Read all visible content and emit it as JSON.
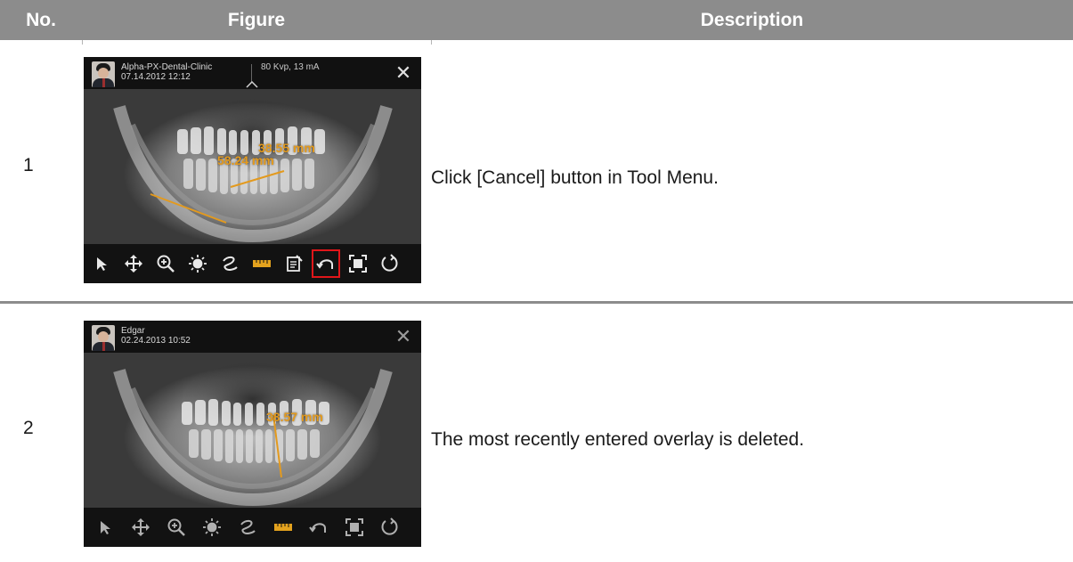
{
  "header": {
    "col_no": "No.",
    "col_figure": "Figure",
    "col_description": "Description"
  },
  "rows": [
    {
      "no": "1",
      "description": "Click [Cancel] button in Tool Menu.",
      "viewer": {
        "patient_name": "Alpha-PX-Dental-Clinic",
        "datetime": "07.14.2012 12:12",
        "exposure": "80 Kvp, 13 mA",
        "measurements": [
          "38.55 mm",
          "58.24 mm"
        ],
        "highlighted_tool": "cancel-icon"
      }
    },
    {
      "no": "2",
      "description": "The most recently entered overlay is deleted.",
      "viewer": {
        "patient_name": "Edgar",
        "datetime": "02.24.2013 10:52",
        "exposure": "",
        "measurements": [
          "38.57 mm"
        ],
        "highlighted_tool": ""
      }
    }
  ],
  "toolbar": {
    "icons": [
      "pointer-icon",
      "pan-icon",
      "zoom-icon",
      "brightness-icon",
      "freehand-icon",
      "ruler-icon",
      "memo-icon",
      "cancel-icon",
      "fit-screen-icon",
      "rotate-icon"
    ]
  },
  "colors": {
    "header_bg": "#8c8c8c",
    "measurement": "#e39a1e",
    "highlight": "#e0161a",
    "ruler_icon": "#e3a21e"
  }
}
